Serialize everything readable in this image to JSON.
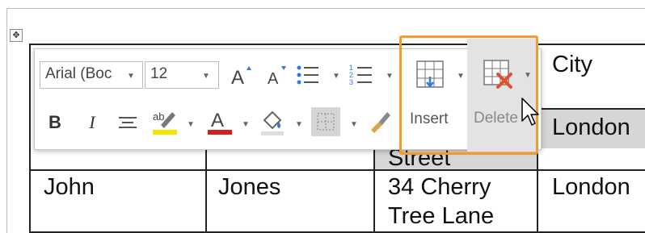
{
  "font_box": {
    "font_name": "Arial (Boc",
    "font_size": "12"
  },
  "toolbar": {
    "insert_label": "Insert",
    "delete_label": "Delete"
  },
  "table": {
    "header_visible": {
      "city": "City"
    },
    "row1": {
      "street_fragment": "Street",
      "city": "London"
    },
    "row2": {
      "first": "John",
      "last": "Jones",
      "address_line1": "34 Cherry",
      "address_line2": "Tree Lane",
      "city": "London"
    }
  },
  "colors": {
    "highlight_orange": "#ef9b2e",
    "font_color_red": "#d62020",
    "highlight_yellow": "#f4e500",
    "insert_arrow_blue": "#2f7bd8",
    "delete_x_red": "#e04f2f"
  },
  "icons": [
    "move-handle-icon",
    "grow-font-icon",
    "shrink-font-icon",
    "bullets-icon",
    "numbering-icon",
    "table-insert-icon",
    "table-delete-icon",
    "bold-icon",
    "italic-icon",
    "center-align-icon",
    "highlight-icon",
    "font-color-icon",
    "shading-icon",
    "borders-icon",
    "format-painter-icon",
    "mouse-cursor-icon"
  ]
}
